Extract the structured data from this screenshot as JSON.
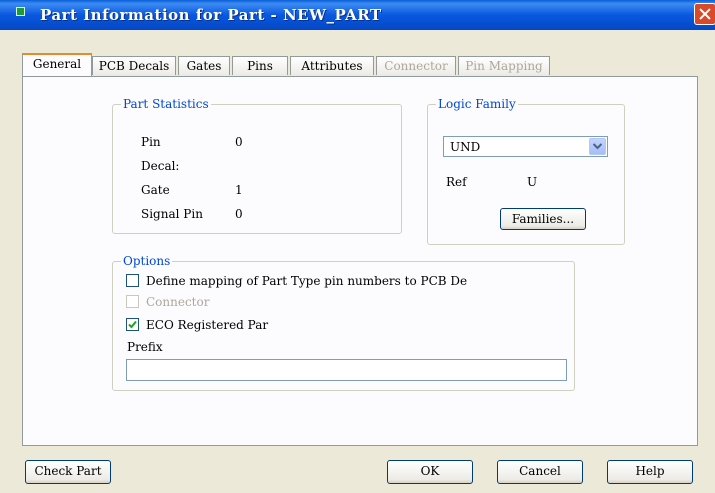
{
  "window": {
    "title": "Part Information for Part - NEW_PART"
  },
  "tabs": [
    {
      "label": "General",
      "state": "active"
    },
    {
      "label": "PCB Decals",
      "state": "normal"
    },
    {
      "label": "Gates",
      "state": "normal"
    },
    {
      "label": "Pins",
      "state": "normal"
    },
    {
      "label": "Attributes",
      "state": "normal"
    },
    {
      "label": "Connector",
      "state": "disabled"
    },
    {
      "label": "Pin Mapping",
      "state": "disabled"
    }
  ],
  "part_statistics": {
    "title": "Part Statistics",
    "rows": [
      {
        "label": "Pin",
        "value": "0"
      },
      {
        "label": "Decal:",
        "value": ""
      },
      {
        "label": "Gate",
        "value": "1"
      },
      {
        "label": "Signal Pin",
        "value": "0"
      }
    ]
  },
  "logic_family": {
    "title": "Logic Family",
    "selected": "UND",
    "ref_label": "Ref",
    "ref_value": "U",
    "families_button": "Families..."
  },
  "options": {
    "title": "Options",
    "define_mapping": {
      "label": "Define mapping of Part Type pin numbers to PCB De",
      "checked": false
    },
    "connector": {
      "label": "Connector",
      "checked": false,
      "enabled": false
    },
    "eco_registered": {
      "label": "ECO Registered Par",
      "checked": true
    },
    "prefix_label": "Prefix",
    "prefix_value": ""
  },
  "buttons": {
    "check_part": "Check Part",
    "ok": "OK",
    "cancel": "Cancel",
    "help": "Help"
  },
  "colors": {
    "title_bar": "#0a58e0",
    "group_label": "#0046d5",
    "dialog_bg": "#ece9d8",
    "active_tab_accent": "#e68b2c"
  }
}
